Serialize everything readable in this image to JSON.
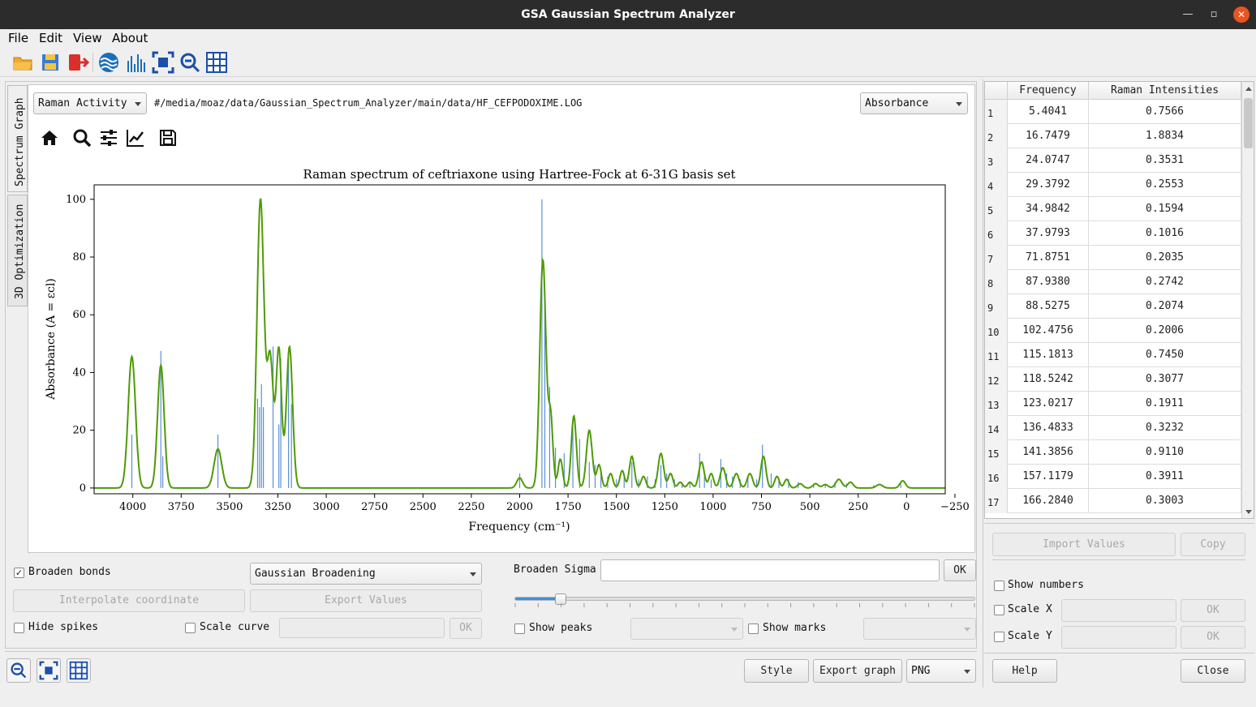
{
  "window": {
    "title": "GSA Gaussian Spectrum Analyzer"
  },
  "menu": [
    "File",
    "Edit",
    "View",
    "About"
  ],
  "toolbar_icons": [
    "open-folder-icon",
    "save-icon",
    "exit-icon",
    "water-icon",
    "spectrum-icon",
    "fit-view-icon",
    "zoom-out-icon",
    "grid-icon"
  ],
  "tabs": {
    "spectrum_graph": "Spectrum Graph",
    "optimization": "3D Optimization"
  },
  "graph_controls": {
    "mode_combo": "Raman Activity",
    "file_path": "#/media/moaz/data/Gaussian_Spectrum_Analyzer/main/data/HF_CEFPODOXIME.LOG",
    "y_mode_combo": "Absorbance"
  },
  "chart_data": {
    "type": "line",
    "title": "Raman spectrum of ceftriaxone using Hartree-Fock at 6-31G basis set",
    "xlabel": "Frequency (cm⁻¹)",
    "ylabel": "Absorbance (A = εcl)",
    "xlim": [
      4200,
      -200
    ],
    "ylim": [
      -2,
      105
    ],
    "x_ticks": [
      "4000",
      "3750",
      "3500",
      "3250",
      "3000",
      "2750",
      "2500",
      "2250",
      "2000",
      "1750",
      "1500",
      "1250",
      "1000",
      "750",
      "500",
      "250",
      "0",
      "−250"
    ],
    "y_ticks": [
      "0",
      "20",
      "40",
      "60",
      "80",
      "100"
    ],
    "series": [
      {
        "color": "#4e9a06",
        "peaks": [
          [
            4005,
            45.5,
            19
          ],
          [
            3855,
            42.5,
            17
          ],
          [
            3560,
            13.5,
            20
          ],
          [
            3340,
            100,
            18
          ],
          [
            3290,
            45,
            16
          ],
          [
            3245,
            48,
            14
          ],
          [
            3190,
            49,
            16
          ],
          [
            2000,
            3.5,
            15
          ],
          [
            1880,
            79,
            16
          ],
          [
            1840,
            24,
            12
          ],
          [
            1790,
            10,
            12
          ],
          [
            1720,
            25,
            13
          ],
          [
            1640,
            20,
            15
          ],
          [
            1590,
            8,
            12
          ],
          [
            1530,
            5,
            12
          ],
          [
            1470,
            6,
            12
          ],
          [
            1420,
            11,
            13
          ],
          [
            1360,
            4,
            12
          ],
          [
            1270,
            12,
            14
          ],
          [
            1220,
            5,
            12
          ],
          [
            1170,
            2,
            12
          ],
          [
            1120,
            2,
            12
          ],
          [
            1060,
            9,
            14
          ],
          [
            1010,
            5,
            12
          ],
          [
            950,
            7,
            14
          ],
          [
            880,
            5,
            14
          ],
          [
            810,
            5,
            14
          ],
          [
            740,
            11,
            13
          ],
          [
            670,
            4,
            12
          ],
          [
            620,
            3,
            12
          ],
          [
            550,
            1.5,
            14
          ],
          [
            470,
            1.5,
            14
          ],
          [
            420,
            1.2,
            14
          ],
          [
            350,
            3,
            16
          ],
          [
            290,
            2,
            14
          ],
          [
            140,
            1.2,
            16
          ],
          [
            20,
            2.5,
            14
          ]
        ]
      }
    ],
    "sticks": [
      [
        4005,
        18.5
      ],
      [
        3855,
        47.5
      ],
      [
        3845,
        11
      ],
      [
        3560,
        18.5
      ],
      [
        3355,
        31
      ],
      [
        3345,
        28
      ],
      [
        3335,
        36
      ],
      [
        3325,
        28
      ],
      [
        3275,
        49
      ],
      [
        3245,
        22
      ],
      [
        3235,
        45
      ],
      [
        3195,
        45
      ],
      [
        3180,
        29
      ],
      [
        2000,
        5
      ],
      [
        1885,
        100
      ],
      [
        1870,
        62
      ],
      [
        1845,
        35
      ],
      [
        1815,
        14
      ],
      [
        1770,
        12
      ],
      [
        1725,
        22
      ],
      [
        1690,
        17
      ],
      [
        1640,
        9
      ],
      [
        1610,
        8
      ],
      [
        1580,
        5
      ],
      [
        1545,
        4
      ],
      [
        1500,
        3
      ],
      [
        1460,
        5
      ],
      [
        1420,
        9
      ],
      [
        1385,
        3
      ],
      [
        1340,
        4
      ],
      [
        1300,
        3
      ],
      [
        1270,
        8
      ],
      [
        1240,
        5
      ],
      [
        1200,
        3
      ],
      [
        1160,
        2
      ],
      [
        1120,
        2
      ],
      [
        1070,
        12
      ],
      [
        1045,
        4
      ],
      [
        1010,
        3
      ],
      [
        960,
        10
      ],
      [
        930,
        5
      ],
      [
        900,
        4
      ],
      [
        860,
        3
      ],
      [
        820,
        4
      ],
      [
        775,
        3
      ],
      [
        745,
        15
      ],
      [
        700,
        5
      ],
      [
        660,
        3
      ],
      [
        610,
        3
      ],
      [
        560,
        2
      ],
      [
        480,
        1.5
      ],
      [
        420,
        1.5
      ],
      [
        370,
        2
      ],
      [
        310,
        1.5
      ],
      [
        170,
        1
      ],
      [
        30,
        1.5
      ]
    ]
  },
  "bottom_controls": {
    "broaden_bonds": "Broaden bonds",
    "broadening_combo": "Gaussian Broadening",
    "broaden_sigma": "Broaden Sigma",
    "ok": "OK",
    "interpolate": "Interpolate coordinate",
    "export_values": "Export Values",
    "hide_spikes": "Hide spikes",
    "scale_curve": "Scale curve",
    "show_peaks": "Show peaks",
    "show_marks": "Show marks",
    "slider_value": 0.1,
    "style": "Style",
    "export_graph": "Export graph",
    "format_combo": "PNG"
  },
  "table": {
    "headers": [
      "Frequency",
      "Raman Intensities"
    ],
    "rows": [
      [
        "1",
        "5.4041",
        "0.7566"
      ],
      [
        "2",
        "16.7479",
        "1.8834"
      ],
      [
        "3",
        "24.0747",
        "0.3531"
      ],
      [
        "4",
        "29.3792",
        "0.2553"
      ],
      [
        "5",
        "34.9842",
        "0.1594"
      ],
      [
        "6",
        "37.9793",
        "0.1016"
      ],
      [
        "7",
        "71.8751",
        "0.2035"
      ],
      [
        "8",
        "87.9380",
        "0.2742"
      ],
      [
        "9",
        "88.5275",
        "0.2074"
      ],
      [
        "10",
        "102.4756",
        "0.2006"
      ],
      [
        "11",
        "115.1813",
        "0.7450"
      ],
      [
        "12",
        "118.5242",
        "0.3077"
      ],
      [
        "13",
        "123.0217",
        "0.1911"
      ],
      [
        "14",
        "136.4833",
        "0.3232"
      ],
      [
        "15",
        "141.3856",
        "0.9110"
      ],
      [
        "16",
        "157.1179",
        "0.3911"
      ],
      [
        "17",
        "166.2840",
        "0.3003"
      ]
    ]
  },
  "right_controls": {
    "import_values": "Import Values",
    "copy": "Copy",
    "show_numbers": "Show numbers",
    "scale_x": "Scale X",
    "scale_y": "Scale Y",
    "ok": "OK",
    "help": "Help",
    "close": "Close"
  }
}
